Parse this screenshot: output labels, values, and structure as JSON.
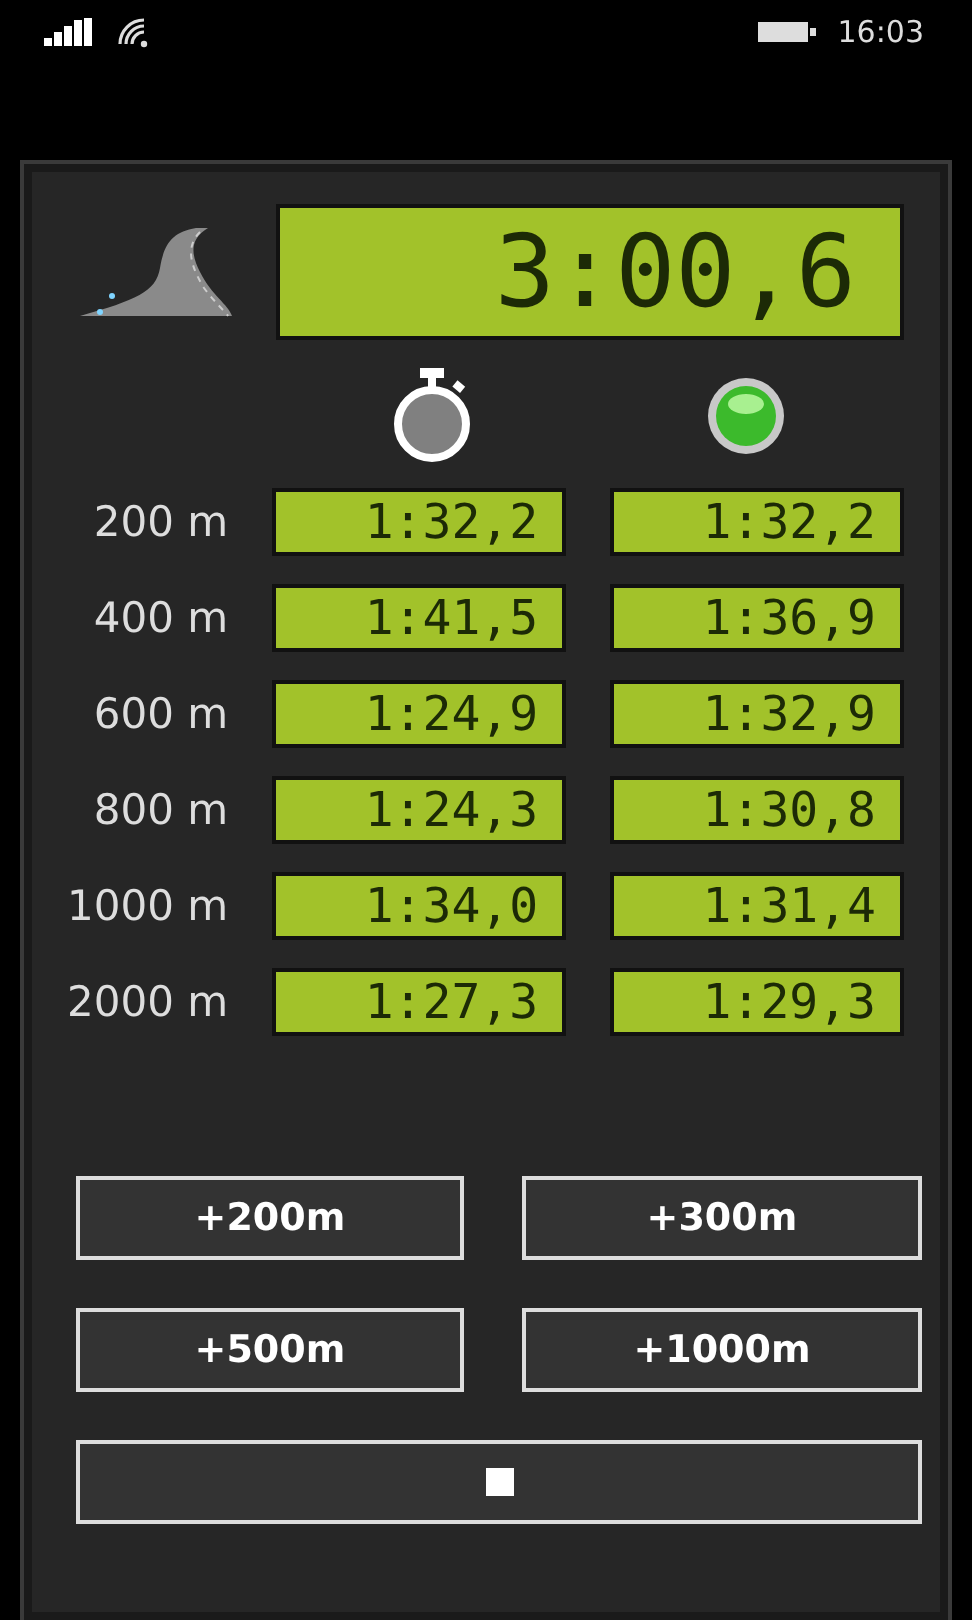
{
  "status_bar": {
    "time": "16:03"
  },
  "main_display": {
    "value": "3:00,6"
  },
  "indicator": {
    "on": true
  },
  "splits": [
    {
      "distance": "200 m",
      "lap": "1:32,2",
      "average": "1:32,2"
    },
    {
      "distance": "400 m",
      "lap": "1:41,5",
      "average": "1:36,9"
    },
    {
      "distance": "600 m",
      "lap": "1:24,9",
      "average": "1:32,9"
    },
    {
      "distance": "800 m",
      "lap": "1:24,3",
      "average": "1:30,8"
    },
    {
      "distance": "1000 m",
      "lap": "1:34,0",
      "average": "1:31,4"
    },
    {
      "distance": "2000 m",
      "lap": "1:27,3",
      "average": "1:29,3"
    }
  ],
  "buttons": [
    {
      "kind": "add",
      "label": "+200m"
    },
    {
      "kind": "add",
      "label": "+300m"
    },
    {
      "kind": "add",
      "label": "+500m"
    },
    {
      "kind": "add",
      "label": "+1000m"
    },
    {
      "kind": "stop"
    }
  ]
}
